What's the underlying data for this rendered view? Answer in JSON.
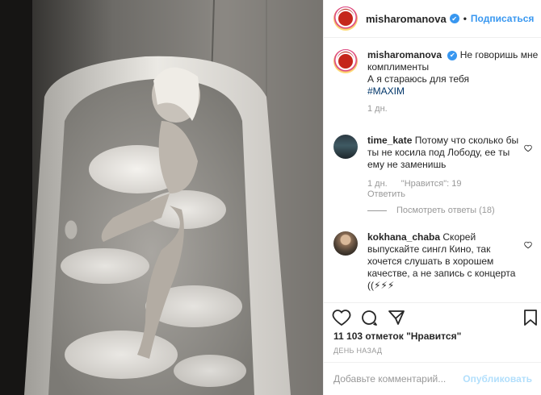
{
  "post": {
    "author": "misharomanova",
    "follow_label": "Подписаться",
    "separator": "•",
    "verified_glyph": "✔"
  },
  "caption": {
    "author": "misharomanova",
    "text": "Не говоришь мне комплименты",
    "line2": "А я стараюсь для тебя",
    "hashtag": "#MAXIM",
    "age": "1 дн."
  },
  "comments": [
    {
      "author": "time_kate",
      "text": "Потому что сколько бы ты не косила под Лободу, ее ты ему не заменишь",
      "age": "1 дн.",
      "likes": "\"Нравится\": 19",
      "reply_label": "Ответить",
      "view_replies": "Посмотреть ответы (18)"
    },
    {
      "author": "kokhana_chaba",
      "text": "Скорей выпускайте сингл Кино, так хочется слушать в хорошем качестве, а не запись с концерта ((⚡⚡⚡"
    }
  ],
  "likes_text": "11 103 отметок \"Нравится\"",
  "time_ago": "ДЕНЬ НАЗАД",
  "add_comment": {
    "placeholder": "Добавьте комментарий...",
    "publish_label": "Опубликовать"
  },
  "icons": [
    "heart-icon",
    "comment-icon",
    "share-icon",
    "bookmark-icon",
    "verified-icon"
  ],
  "colors": {
    "accent": "#3897f0",
    "muted": "#999999",
    "text": "#262626",
    "publish_disabled": "#b2dffc"
  }
}
